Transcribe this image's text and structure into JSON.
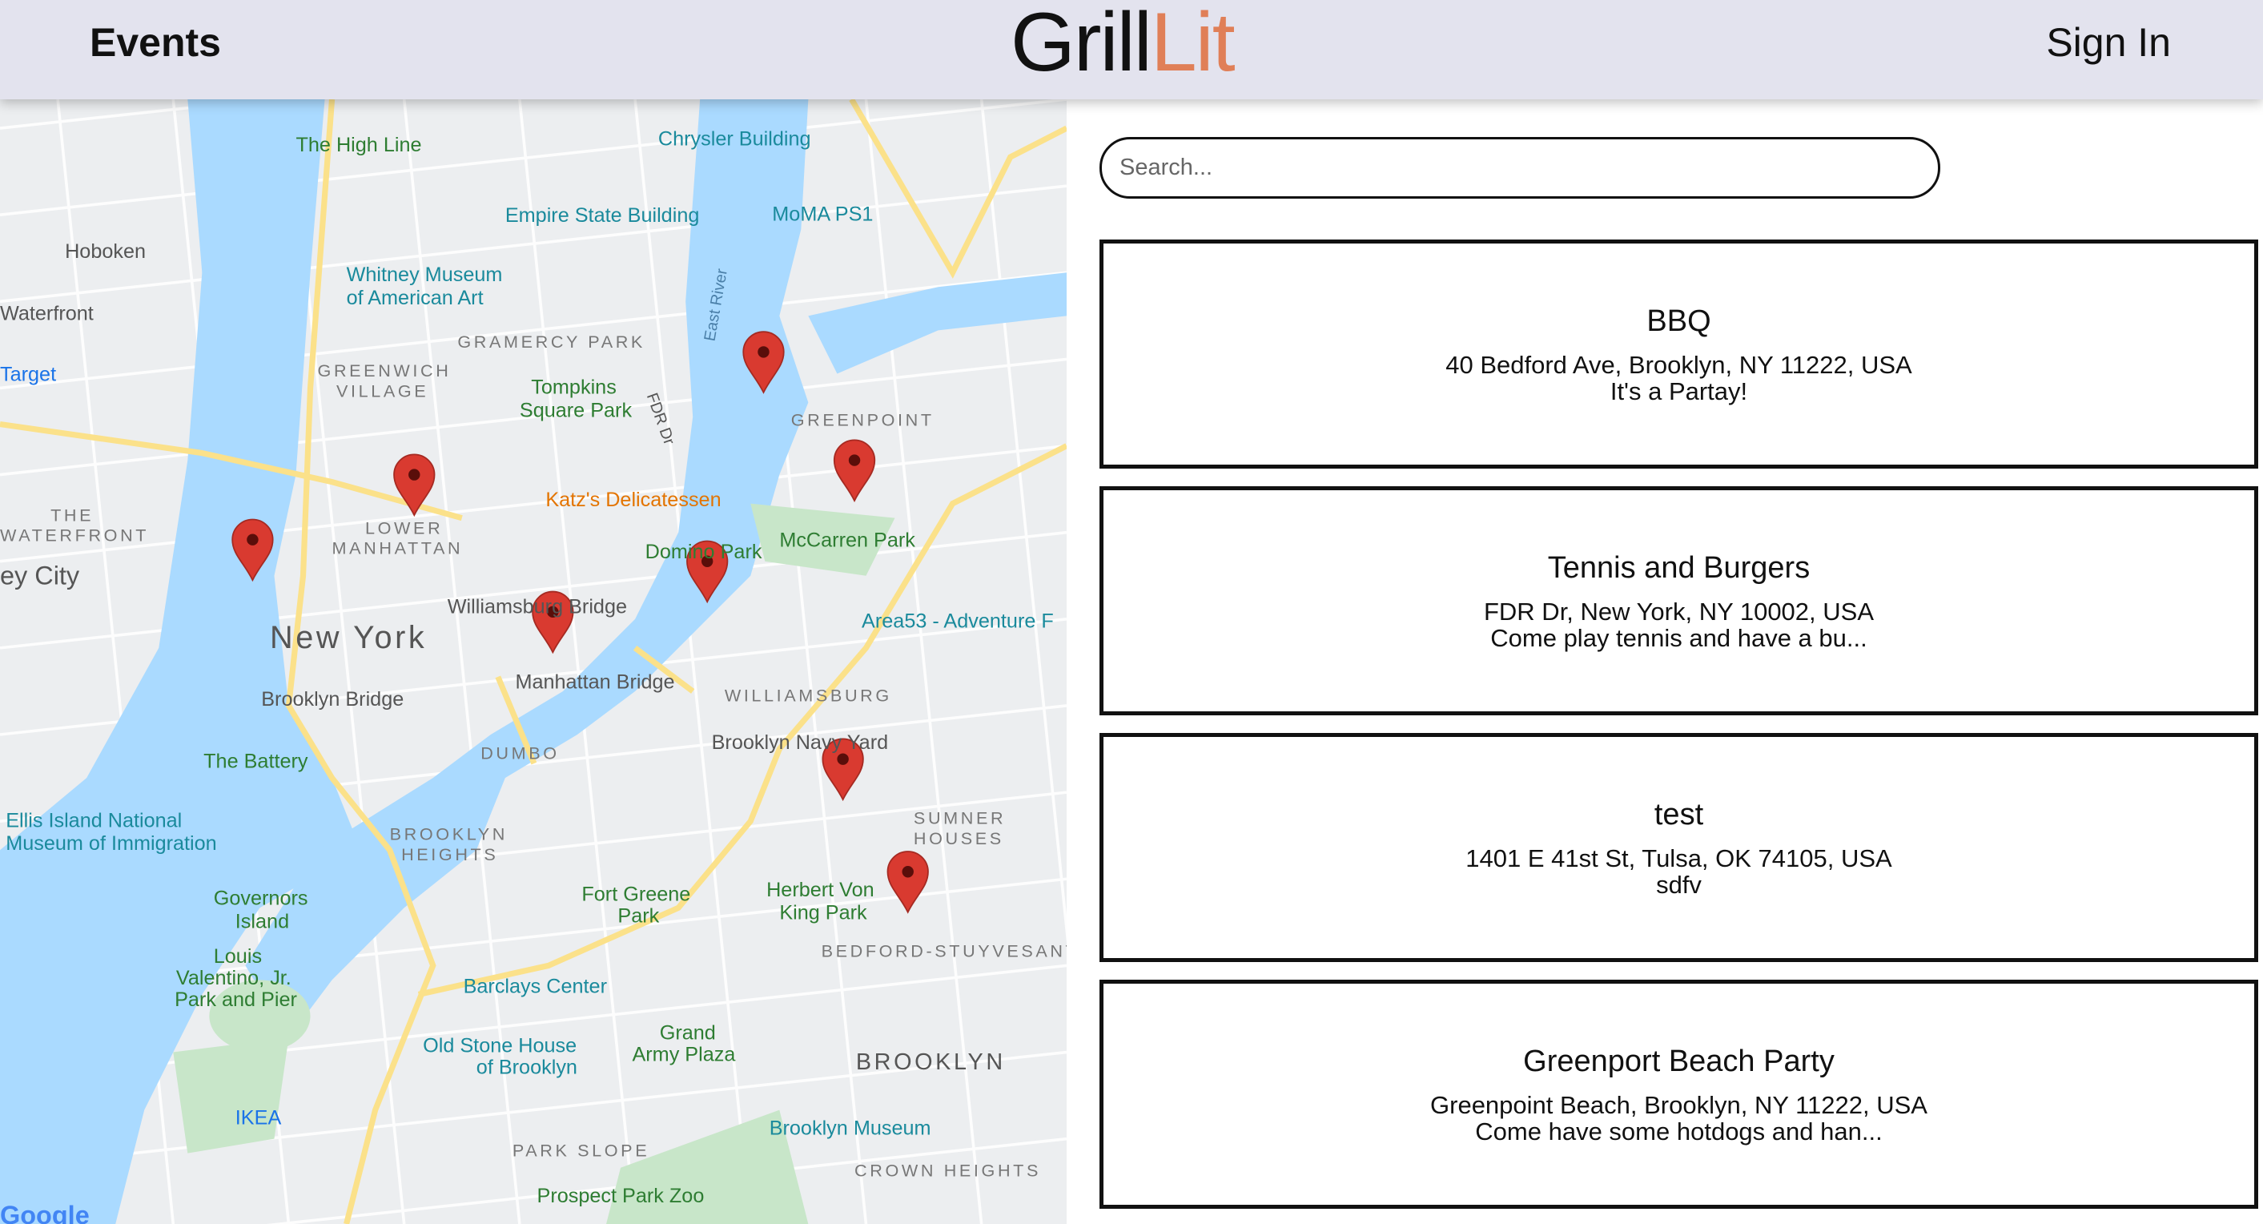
{
  "header": {
    "events_label": "Events",
    "logo_part1": "Grill",
    "logo_part2": "Lit",
    "sign_in_label": "Sign In"
  },
  "colors": {
    "logo_accent": "#e07f57",
    "header_bg": "#e3e3ee",
    "pin": "#d93a30",
    "water": "#aadaff"
  },
  "search": {
    "placeholder": "Search...",
    "value": ""
  },
  "events": [
    {
      "title": "BBQ",
      "address": "40 Bedford Ave, Brooklyn, NY 11222, USA",
      "description": "It's a Partay!"
    },
    {
      "title": "Tennis and Burgers",
      "address": "FDR Dr, New York, NY 10002, USA",
      "description": "Come play tennis and have a bu..."
    },
    {
      "title": "test",
      "address": "1401 E 41st St, Tulsa, OK 74105, USA",
      "description": "sdfv"
    },
    {
      "title": "Greenport Beach Party",
      "address": "Greenpoint Beach, Brooklyn, NY 11222, USA",
      "description": "Come have some hotdogs and han..."
    }
  ],
  "map": {
    "labels": [
      "The High Line",
      "Chrysler Building",
      "Empire State Building",
      "MoMA PS1",
      "Hoboken",
      "Whitney Museum",
      "of American Art",
      "GRAMERCY PARK",
      "GREENWICH",
      "VILLAGE",
      "Tompkins",
      "Square Park",
      "GREENPOINT",
      "Katz's Delicatessen",
      "McCarren Park",
      "LOWER",
      "MANHATTAN",
      "THE",
      "WATERFRONT",
      "New York",
      "Williamsburg Bridge",
      "Area53 - Adventure F",
      "Manhattan Bridge",
      "WILLIAMSBURG",
      "Brooklyn Bridge",
      "The Battery",
      "Brooklyn Navy Yard",
      "DUMBO",
      "Ellis Island National",
      "Museum of Immigration",
      "BROOKLYN",
      "HEIGHTS",
      "Fort Greene",
      "Park",
      "Herbert Von",
      "King Park",
      "SUMNER",
      "HOUSES",
      "Governors",
      "Island",
      "BEDFORD-STUYVESANT",
      "Louis",
      "Valentino, Jr.",
      "Park and Pier",
      "Barclays Center",
      "Old Stone House",
      "of Brooklyn",
      "Grand",
      "Army Plaza",
      "BROOKLYN",
      "IKEA",
      "Brooklyn Museum",
      "PARK SLOPE",
      "CROWN HEIGHTS",
      "Prospect Park Zoo",
      "Waterfront",
      "Target",
      "ey City",
      "Domino Park",
      "East River",
      "FDR Dr",
      "Google"
    ],
    "pin_count": 8
  }
}
